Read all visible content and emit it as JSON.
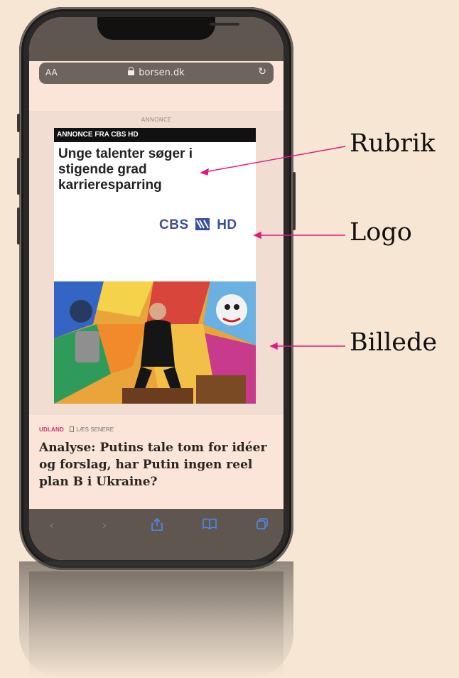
{
  "browser": {
    "text_size_label": "AA",
    "domain": "borsen.dk"
  },
  "ad": {
    "label": "ANNONCE",
    "header": "ANNONCE FRA CBS HD",
    "headline": "Unge talenter søger i stigende grad karrieresparring",
    "logo_left": "CBS",
    "logo_right": "HD",
    "logo_color": "#3a4fa0"
  },
  "article": {
    "category": "UDLAND",
    "read_later": "LÆS SENERE",
    "headline": "Analyse: Putins tale tom for idéer og forslag, har Putin ingen reel plan B i Ukraine?",
    "category_color": "#c8356b"
  },
  "toolbar": {
    "icons": [
      "back-icon",
      "forward-icon",
      "share-icon",
      "bookmarks-icon",
      "tabs-icon"
    ],
    "accent": "#4d8bf5"
  },
  "annotations": {
    "headline": "Rubrik",
    "logo": "Logo",
    "image": "Billede",
    "arrow_color": "#e0197d"
  }
}
